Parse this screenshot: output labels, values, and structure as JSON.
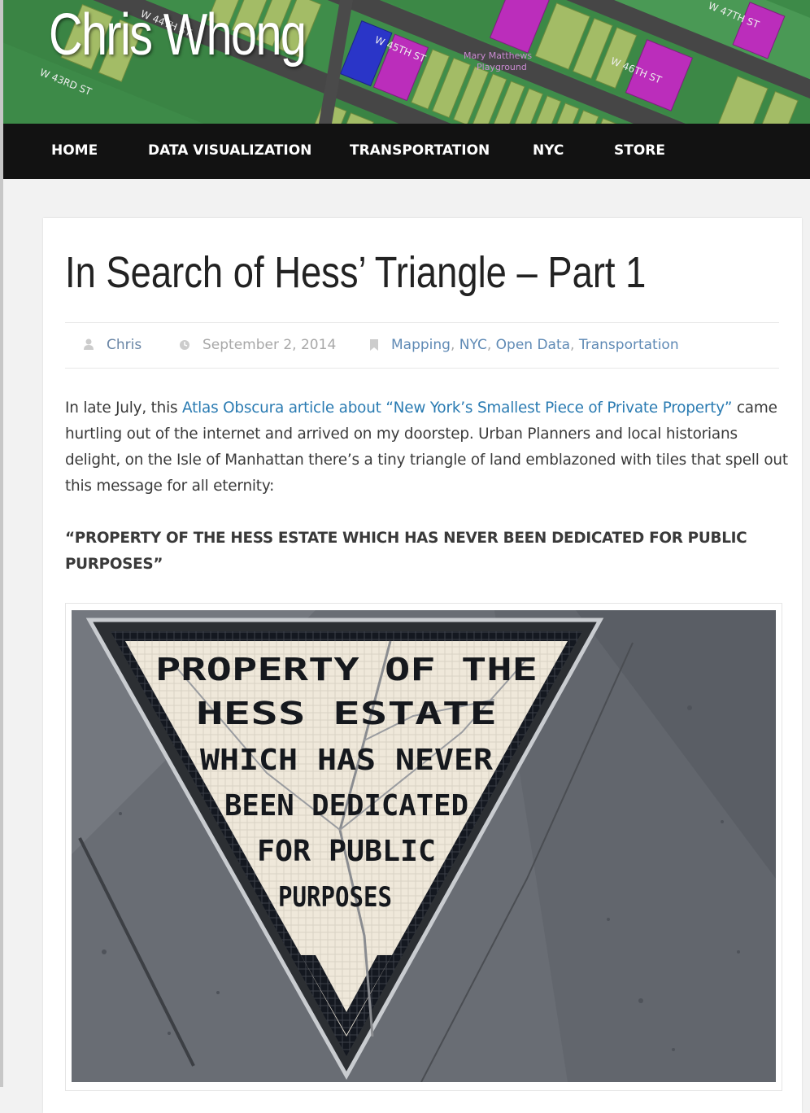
{
  "site": {
    "title": "Chris Whong",
    "map_labels": [
      "W 44TH ST",
      "W 45TH ST",
      "W 46TH ST",
      "W 47TH ST",
      "W 43RD ST",
      "Mary Matthews Playground"
    ]
  },
  "nav": {
    "items": [
      "HOME",
      "DATA VISUALIZATION",
      "TRANSPORTATION",
      "NYC",
      "STORE"
    ]
  },
  "post": {
    "title": "In Search of Hess’ Triangle – Part 1",
    "author": "Chris",
    "date": "September 2, 2014",
    "categories": [
      "Mapping",
      "NYC",
      "Open Data",
      "Transportation"
    ],
    "category_separator": ",",
    "intro_prefix": "In late July, this ",
    "intro_link": "Atlas Obscura article about “New York’s Smallest Piece of Private Property”",
    "intro_suffix": " came hurtling out of the internet and arrived on my doorstep.  Urban Planners and local historians delight, on the Isle of Manhattan there’s a tiny triangle of land emblazoned with tiles that spell out this message for all eternity:",
    "quote": "“PROPERTY OF THE HESS ESTATE WHICH HAS NEVER BEEN DEDICATED FOR PUBLIC PURPOSES”",
    "photo_text_lines": [
      "PROPERTY OF THE",
      "HESS ESTATE",
      "WHICH HAS NEVER",
      "BEEN DEDICATED",
      "FOR PUBLIC",
      "PURPOSES"
    ]
  },
  "icons": {
    "author": "user-icon",
    "date": "clock-icon",
    "categories": "bookmark-icon"
  },
  "colors": {
    "nav_bg": "#121212",
    "link": "#2a7bb2",
    "meta_link": "#5f8ab5",
    "map_green": "#3f8f4a",
    "map_olive": "#9fb865",
    "map_magenta": "#bb2dbb",
    "map_blue": "#2a35c8"
  }
}
